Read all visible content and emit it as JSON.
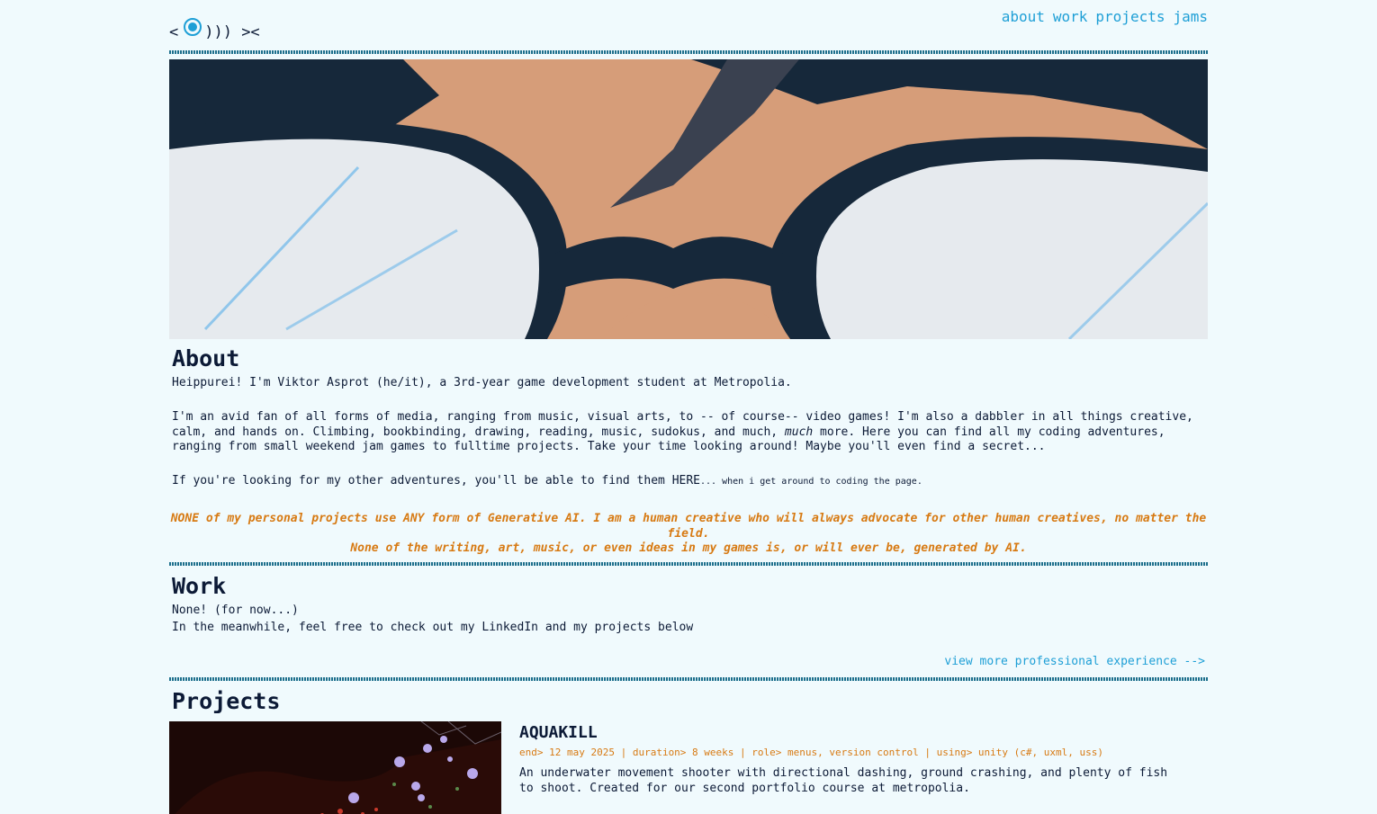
{
  "header": {
    "logo_left": "<",
    "logo_right": "))) ><",
    "nav": [
      "about",
      "work",
      "projects",
      "jams"
    ]
  },
  "about": {
    "heading": "About",
    "intro": "Heippurei! I'm Viktor Asprot (he/it), a 3rd-year game development student at Metropolia.",
    "p2_a": "I'm an avid fan of all forms of media, ranging from music, visual arts, to -- of course-- video games! I'm also a dabbler in all things creative, calm, and hands on. Climbing, bookbinding, drawing, reading, music, sudokus, and much, ",
    "p2_em": "much",
    "p2_b": " more. Here you can find all my coding adventures, ranging from small weekend jam games to fulltime projects. Take your time looking around! Maybe you'll even find a secret...",
    "p3_main": "If you're looking for my other adventures, you'll be able to find them HERE",
    "p3_small": "... when i get around to coding the page.",
    "ai_line1": "NONE of my personal projects use ANY form of Generative AI. I am a human creative who will always advocate for other human creatives, no matter the field.",
    "ai_line2": "None of the writing, art, music, or even ideas in my games is, or will ever be, generated by AI."
  },
  "work": {
    "heading": "Work",
    "line1": "None! (for now...)",
    "line2": "In the meanwhile, feel free to check out my LinkedIn and my projects below",
    "more_link": "view more professional experience -->"
  },
  "projects": {
    "heading": "Projects",
    "items": [
      {
        "title": "AQUAKILL",
        "meta": "end> 12 may 2025 | duration> 8 weeks | role> menus, version control | using> unity (c#, uxml, uss)",
        "desc": "An underwater movement shooter with directional dashing, ground crashing, and plenty of fish to shoot. Created for our second portfolio course at metropolia."
      }
    ]
  },
  "colors": {
    "background": "#f0fafd",
    "accent": "#1e9fd6",
    "text": "#0c1a36",
    "highlight": "#d77a13"
  }
}
